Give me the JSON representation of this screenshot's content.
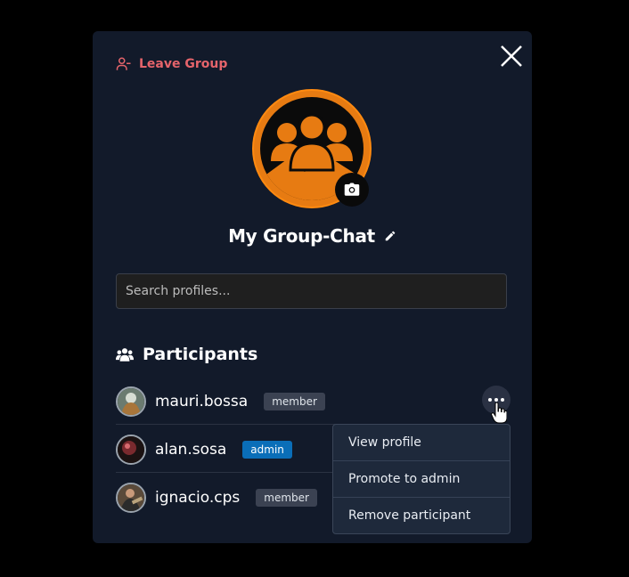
{
  "header": {
    "leave_label": "Leave Group"
  },
  "group": {
    "name": "My Group-Chat"
  },
  "search": {
    "placeholder": "Search profiles..."
  },
  "participants": {
    "heading": "Participants",
    "items": [
      {
        "name": "mauri.bossa",
        "role": "member"
      },
      {
        "name": "alan.sosa",
        "role": "admin"
      },
      {
        "name": "ignacio.cps",
        "role": "member"
      }
    ]
  },
  "context_menu": {
    "items": [
      "View profile",
      "Promote to admin",
      "Remove participant"
    ]
  },
  "colors": {
    "panel_bg": "#121a2a",
    "leave_red": "#e5646b",
    "avatar_orange": "#e77b12",
    "admin_blue": "#0a6eb8",
    "member_gray": "#3b4252"
  },
  "icons": {
    "leave": "user-minus-icon",
    "close": "close-icon",
    "camera": "camera-icon",
    "edit": "pencil-icon",
    "participants": "users-icon",
    "more": "ellipsis-icon"
  }
}
